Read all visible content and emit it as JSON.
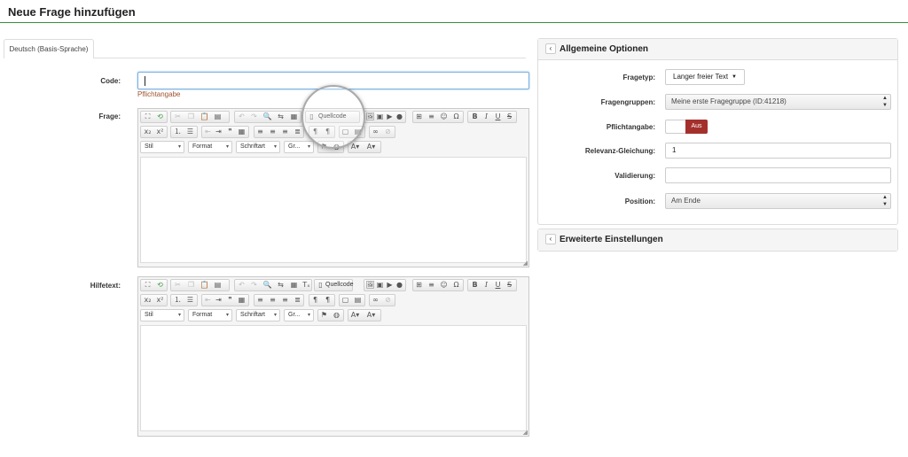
{
  "page": {
    "title": "Neue Frage hinzufügen"
  },
  "language_tab": {
    "label": "Deutsch (Basis-Sprache)"
  },
  "form": {
    "code_label": "Code:",
    "code_value": "",
    "required_note": "Pflichtangabe",
    "question_label": "Frage:",
    "help_label": "Hilfetext:"
  },
  "editor_toolbar": {
    "source_label": "Quellcode",
    "style_label": "Stil",
    "format_label": "Format",
    "font_label": "Schriftart",
    "size_label": "Gr...",
    "bold": "B",
    "italic": "I",
    "underline": "U",
    "strike": "S",
    "subscript": "x₂",
    "superscript": "x²"
  },
  "general_options": {
    "title": "Allgemeine Optionen",
    "question_type_label": "Fragetyp:",
    "question_type_value": "Langer freier Text",
    "group_label": "Fragengruppen:",
    "group_value": "Meine erste Fragegruppe (ID:41218)",
    "mandatory_label": "Pflichtangabe:",
    "mandatory_value": "Aus",
    "relevance_label": "Relevanz-Gleichung:",
    "relevance_value": "1",
    "validation_label": "Validierung:",
    "validation_value": "",
    "position_label": "Position:",
    "position_value": "Am Ende"
  },
  "advanced_settings": {
    "title": "Erweiterte Einstellungen"
  }
}
